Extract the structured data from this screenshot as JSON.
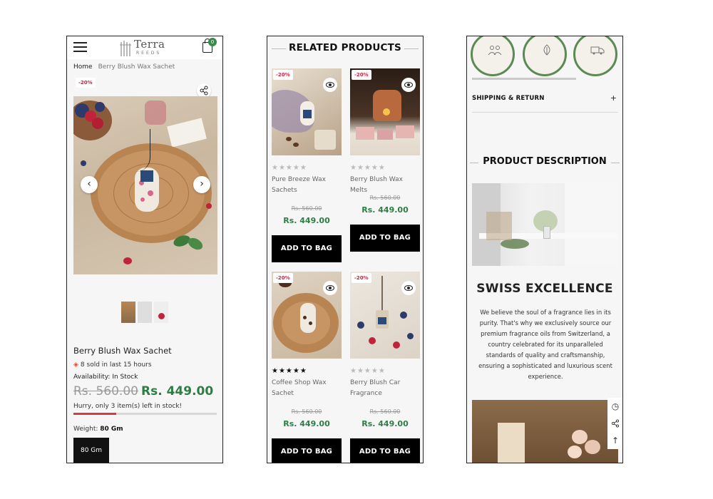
{
  "screen1": {
    "header": {
      "logo_name": "Terra",
      "logo_sub": "REEDS",
      "cart_count": "0"
    },
    "breadcrumb": {
      "home": "Home",
      "current": "Berry Blush Wax Sachet"
    },
    "discount_badge": "-20%",
    "thumbnails": 3,
    "product": {
      "title": "Berry Blush Wax Sachet",
      "sold_text": "8 sold in last 15 hours",
      "availability_label": "Availability:",
      "availability_value": "In Stock",
      "old_price": "Rs. 560.00",
      "new_price": "Rs. 449.00",
      "hurry_text": "Hurry, only 3 item(s) left in stock!",
      "stock_fraction": 0.3,
      "weight_label": "Weight:",
      "weight_value": "80 Gm",
      "weight_option": "80 Gm"
    }
  },
  "screen2": {
    "heading": "RELATED PRODUCTS",
    "products": [
      {
        "badge": "-20%",
        "rating": 0,
        "name": "Pure Breeze Wax Sachets",
        "old_price": "Rs. 560.00",
        "new_price": "Rs. 449.00",
        "button": "ADD TO BAG"
      },
      {
        "badge": "-20%",
        "rating": 0,
        "name": "Berry Blush Wax Melts",
        "old_price": "Rs. 560.00",
        "new_price": "Rs. 449.00",
        "button": "ADD TO BAG"
      },
      {
        "badge": "-20%",
        "rating": 5,
        "name": "Coffee Shop Wax Sachet",
        "old_price": "Rs. 560.00",
        "new_price": "Rs. 449.00",
        "button": "ADD TO BAG"
      },
      {
        "badge": "-20%",
        "rating": 0,
        "name": "Berry Blush Car Fragrance",
        "old_price": "Rs. 560.00",
        "new_price": "Rs. 449.00",
        "button": "ADD TO BAG"
      }
    ]
  },
  "screen3": {
    "shipping_label": "SHIPPING & RETURN",
    "shipping_toggle": "+",
    "desc_heading": "PRODUCT DESCRIPTION",
    "swiss_title": "SWISS EXCELLENCE",
    "swiss_body": "We believe the soul of a fragrance lies in its purity. That's why we exclusively source our premium fragrance oils from Switzerland, a country celebrated for its unparalleled standards of quality and craftsmanship, ensuring a sophisticated and luxurious scent experience."
  },
  "colors": {
    "accent_green": "#2e7d45",
    "discount_red": "#d02040",
    "button_black": "#000000"
  }
}
